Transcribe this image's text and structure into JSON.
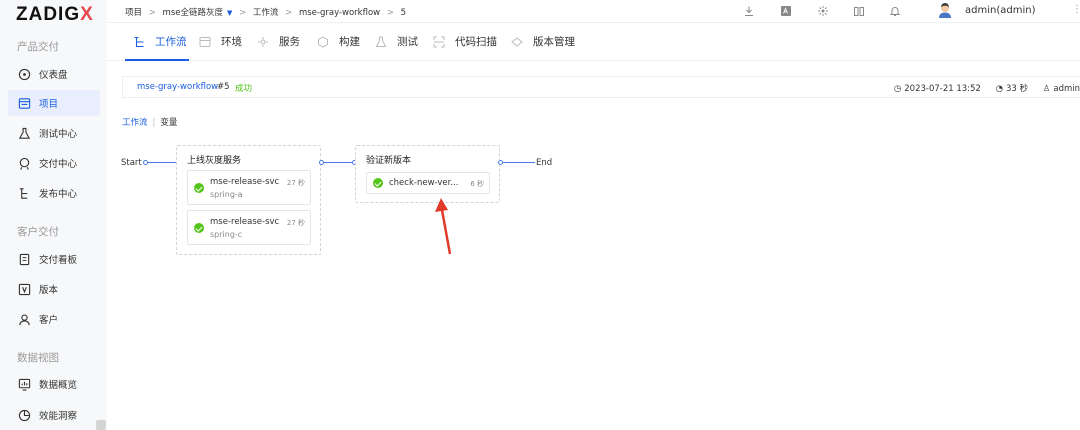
{
  "app": {
    "logo_main": "ZADIG",
    "logo_x": "X"
  },
  "sidebar": {
    "sections": [
      {
        "title": "产品交付"
      },
      {
        "title": "客户交付"
      },
      {
        "title": "数据视图"
      }
    ],
    "items": [
      {
        "label": "仪表盘",
        "icon": "dashboard-icon"
      },
      {
        "label": "项目",
        "icon": "project-icon",
        "active": true
      },
      {
        "label": "测试中心",
        "icon": "flask-icon"
      },
      {
        "label": "交付中心",
        "icon": "delivery-icon"
      },
      {
        "label": "发布中心",
        "icon": "release-icon"
      },
      {
        "label": "交付看板",
        "icon": "board-icon"
      },
      {
        "label": "版本",
        "icon": "version-icon"
      },
      {
        "label": "客户",
        "icon": "customer-icon"
      },
      {
        "label": "数据概览",
        "icon": "chart-icon"
      },
      {
        "label": "效能洞察",
        "icon": "insight-icon"
      }
    ]
  },
  "topbar": {
    "breadcrumb": [
      "项目",
      "mse全链路灰度",
      "工作流",
      "mse-gray-workflow",
      "5"
    ],
    "separator": ">",
    "user": "admin(admin)",
    "icons": [
      "download-icon",
      "translate-icon",
      "plugin-icon",
      "docs-icon",
      "bell-icon"
    ]
  },
  "tabs": [
    {
      "label": "工作流",
      "icon": "workflow-icon",
      "active": true
    },
    {
      "label": "环境",
      "icon": "env-icon"
    },
    {
      "label": "服务",
      "icon": "service-icon"
    },
    {
      "label": "构建",
      "icon": "build-icon"
    },
    {
      "label": "测试",
      "icon": "test-icon"
    },
    {
      "label": "代码扫描",
      "icon": "scan-icon"
    },
    {
      "label": "版本管理",
      "icon": "version-manage-icon"
    }
  ],
  "task": {
    "workflow": "mse-gray-workflow",
    "number": "#5",
    "status": "成功",
    "time": "2023-07-21 13:52",
    "duration": "33 秒",
    "creator": "admin",
    "status_color": "#52c41a"
  },
  "subtabs": {
    "workflow": "工作流",
    "divider": "|",
    "variables": "变量"
  },
  "flow": {
    "start": "Start",
    "end": "End",
    "stages": [
      {
        "title": "上线灰度服务",
        "jobs": [
          {
            "name": "mse-release-svc",
            "sub": "spring-a",
            "time": "27 秒"
          },
          {
            "name": "mse-release-svc",
            "sub": "spring-c",
            "time": "27 秒"
          }
        ]
      },
      {
        "title": "验证新版本",
        "jobs": [
          {
            "name": "check-new-ver...",
            "time": "6 秒"
          }
        ]
      }
    ]
  },
  "colors": {
    "accent": "#1a5de0",
    "success": "#52c41a",
    "annotation": "#e03a2a"
  }
}
